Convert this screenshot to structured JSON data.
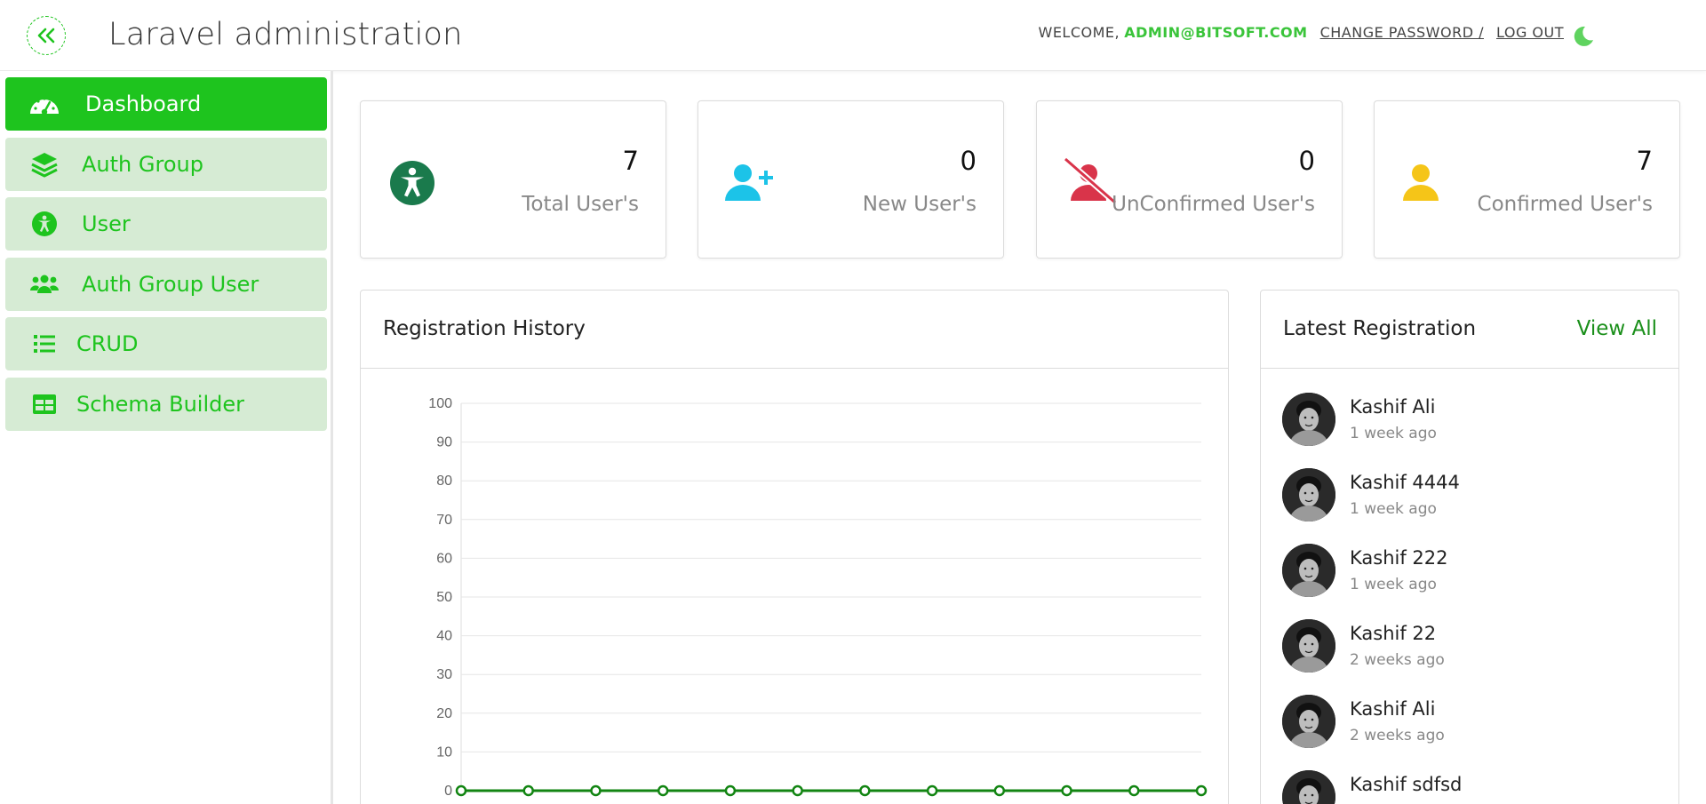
{
  "header": {
    "title": "Laravel administration",
    "welcome": "WELCOME,",
    "email": "ADMIN@BITSOFT.COM",
    "change_password": "CHANGE PASSWORD /",
    "logout": "LOG OUT"
  },
  "sidebar": {
    "items": [
      {
        "label": "Dashboard",
        "icon": "dashboard-gauge-icon",
        "active": true
      },
      {
        "label": "Auth Group",
        "icon": "layers-icon",
        "active": false
      },
      {
        "label": "User",
        "icon": "accessibility-icon",
        "active": false
      },
      {
        "label": "Auth Group User",
        "icon": "users-icon",
        "active": false
      },
      {
        "label": "CRUD",
        "icon": "list-icon",
        "active": false
      },
      {
        "label": "Schema Builder",
        "icon": "table-icon",
        "active": false
      }
    ]
  },
  "stats": [
    {
      "value": "7",
      "label": "Total User's",
      "icon": "accessibility-icon",
      "color": "#1a7a4c"
    },
    {
      "value": "0",
      "label": "New User's",
      "icon": "user-plus-icon",
      "color": "#1cc3e8"
    },
    {
      "value": "0",
      "label": "UnConfirmed User's",
      "icon": "user-slash-icon",
      "color": "#d9344a"
    },
    {
      "value": "7",
      "label": "Confirmed User's",
      "icon": "user-icon",
      "color": "#f5c518"
    }
  ],
  "registration_history": {
    "title": "Registration History"
  },
  "latest_registration": {
    "title": "Latest Registration",
    "view_all": "View All",
    "items": [
      {
        "name": "Kashif Ali",
        "time": "1 week ago"
      },
      {
        "name": "Kashif 4444",
        "time": "1 week ago"
      },
      {
        "name": "Kashif 222",
        "time": "1 week ago"
      },
      {
        "name": "Kashif 22",
        "time": "2 weeks ago"
      },
      {
        "name": "Kashif Ali",
        "time": "2 weeks ago"
      },
      {
        "name": "Kashif sdfsd",
        "time": ""
      }
    ]
  },
  "colors": {
    "accent": "#1ec41e",
    "nav_inactive_bg": "#d6ebd4",
    "line": "#128512"
  },
  "chart_data": {
    "type": "line",
    "title": "Registration History",
    "ylim": [
      0,
      100
    ],
    "yticks": [
      0,
      10,
      20,
      30,
      40,
      50,
      60,
      70,
      80,
      90,
      100
    ],
    "series": [
      {
        "values": [
          0,
          0,
          0,
          0,
          0,
          0,
          0,
          0,
          0,
          0,
          0,
          0
        ]
      }
    ],
    "grid": true
  }
}
